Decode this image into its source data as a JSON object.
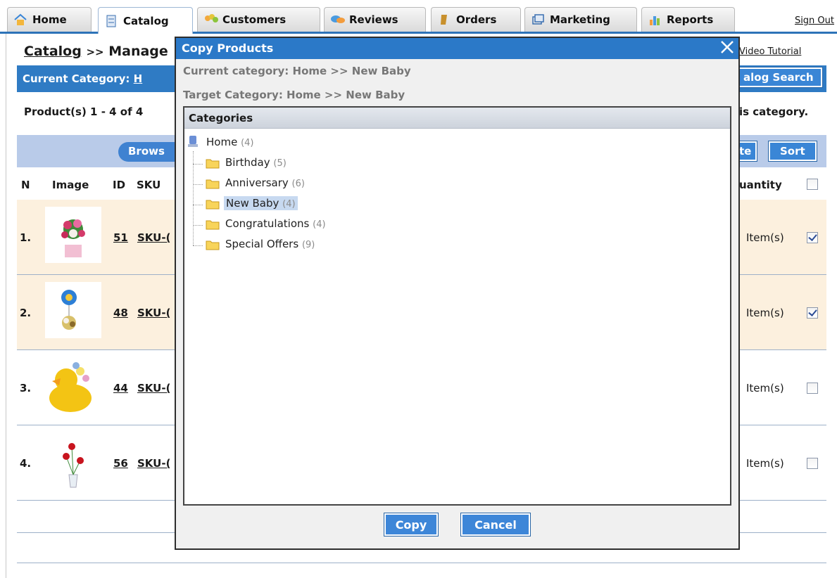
{
  "tabs": [
    {
      "label": "Home",
      "icon": "home-icon"
    },
    {
      "label": "Catalog",
      "icon": "catalog-icon"
    },
    {
      "label": "Customers",
      "icon": "customers-icon"
    },
    {
      "label": "Reviews",
      "icon": "reviews-icon"
    },
    {
      "label": "Orders",
      "icon": "orders-icon"
    },
    {
      "label": "Marketing",
      "icon": "marketing-icon"
    },
    {
      "label": "Reports",
      "icon": "reports-icon"
    }
  ],
  "header": {
    "sign_out": "Sign Out"
  },
  "page": {
    "breadcrumb_link": "Catalog",
    "breadcrumb_sep": ">>",
    "breadcrumb_rest": "Manage",
    "video_tutorial": "Video Tutorial",
    "current_category_label": "Current Category:",
    "current_category_link": "H",
    "catalog_search": "alog Search",
    "product_count": "Product(s) 1 - 4 of 4",
    "this_category": "is category.",
    "browse": "Brows",
    "delete_partial": "te",
    "sort": "Sort"
  },
  "table": {
    "headers": {
      "n": "N",
      "image": "Image",
      "id": "ID",
      "sku": "SKU",
      "quantity": "uantity"
    },
    "rows": [
      {
        "n": "1.",
        "id": "51",
        "sku": "SKU-(",
        "qty": "Item(s)",
        "checked": true
      },
      {
        "n": "2.",
        "id": "48",
        "sku": "SKU-(",
        "qty": "Item(s)",
        "checked": true
      },
      {
        "n": "3.",
        "id": "44",
        "sku": "SKU-(",
        "qty": "Item(s)",
        "checked": false
      },
      {
        "n": "4.",
        "id": "56",
        "sku": "SKU-(",
        "qty": "Item(s)",
        "checked": false
      }
    ]
  },
  "modal": {
    "title": "Copy Products",
    "current_category": "Current category: Home >> New Baby",
    "target_category": "Target Category: Home >> New Baby",
    "tree_header": "Categories",
    "root": {
      "label": "Home",
      "count": "(4)"
    },
    "children": [
      {
        "label": "Birthday",
        "count": "(5)",
        "selected": false
      },
      {
        "label": "Anniversary",
        "count": "(6)",
        "selected": false
      },
      {
        "label": "New Baby",
        "count": "(4)",
        "selected": true
      },
      {
        "label": "Congratulations",
        "count": "(4)",
        "selected": false
      },
      {
        "label": "Special Offers",
        "count": "(9)",
        "selected": false
      }
    ],
    "copy_button": "Copy",
    "cancel_button": "Cancel"
  },
  "colors": {
    "accent": "#2b79c8",
    "selected_row": "#fcf0de",
    "toolbar": "#b9cbe9"
  }
}
